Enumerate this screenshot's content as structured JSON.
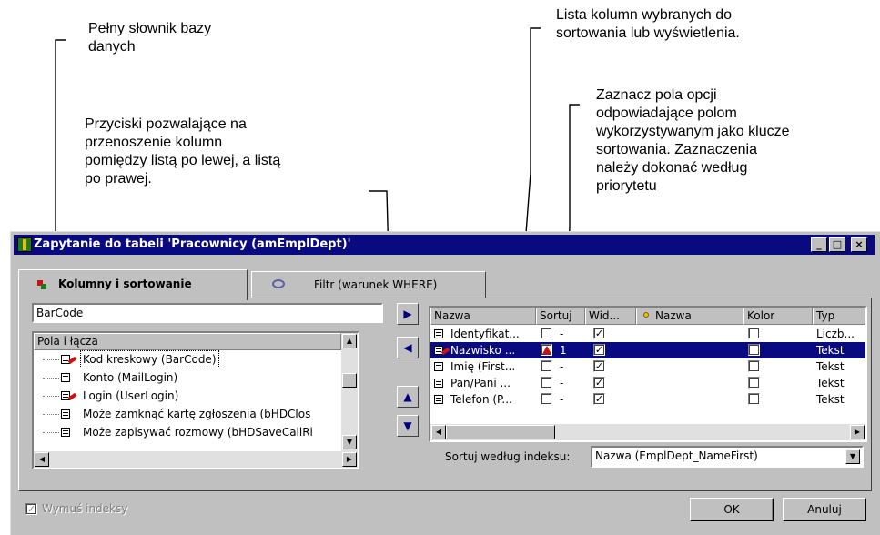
{
  "annotations": {
    "dictionary": "Pełny słownik bazy\ndanych",
    "columns_list": "Lista kolumn wybranych do\nsortowania lub wyświetlenia.",
    "checkboxes": "Zaznacz pola opcji\nodpowiadające polom\nwykorzystywanym jako klucze\nsortowania. Zaznaczenia\nnależy dokonać według\npriorytetu",
    "buttons": "Przyciski pozwalające na\nprzenoszenie kolumn\npomiędzy listą po lewej, a listą\npo prawej."
  },
  "window": {
    "title": "Zapytanie do tabeli 'Pracownicy (amEmplDept)'",
    "minimize": "_",
    "maximize": "□",
    "close": "×"
  },
  "tabs": [
    {
      "label": "Kolumny i sortowanie",
      "active": true,
      "icon": "columns-icon"
    },
    {
      "label": "Filtr (warunek WHERE)",
      "active": false,
      "icon": "filter-icon"
    }
  ],
  "left": {
    "search_value": "BarCode",
    "tree_header": "Pola i łącza",
    "items": [
      {
        "label": "Kod kreskowy (BarCode)",
        "icon": "linked-field-icon",
        "selected": true
      },
      {
        "label": "Konto (MailLogin)",
        "icon": "field-icon",
        "selected": false
      },
      {
        "label": "Login (UserLogin)",
        "icon": "linked-field-icon",
        "selected": false
      },
      {
        "label": "Może zamknąć kartę zgłoszenia (bHDClos",
        "icon": "field-icon",
        "selected": false
      },
      {
        "label": "Może zapisywać rozmowy (bHDSaveCallRi",
        "icon": "field-icon",
        "selected": false
      }
    ]
  },
  "move_buttons": [
    "▶",
    "◀",
    "▲",
    "▼"
  ],
  "grid": {
    "headers": [
      "Nazwa",
      "Sortuj",
      "Wid...",
      "Nazwa",
      "Kolor",
      "Typ"
    ],
    "rows": [
      {
        "name": "Identyfikat...",
        "sort": false,
        "sort_order": "-",
        "visible": true,
        "color": false,
        "type": "Liczb..."
      },
      {
        "name": "Nazwisko ...",
        "sort": true,
        "sort_order": "1",
        "visible": true,
        "color": false,
        "type": "Tekst"
      },
      {
        "name": "Imię (First...",
        "sort": false,
        "sort_order": "-",
        "visible": true,
        "color": false,
        "type": "Tekst"
      },
      {
        "name": "Pan/Pani ...",
        "sort": false,
        "sort_order": "-",
        "visible": true,
        "color": false,
        "type": "Tekst"
      },
      {
        "name": "Telefon (P...",
        "sort": false,
        "sort_order": "-",
        "visible": true,
        "color": false,
        "type": "Tekst"
      }
    ],
    "selected_row": 1
  },
  "index_sort": {
    "label": "Sortuj według indeksu:",
    "value": "Nazwa (EmplDept_NameFirst)"
  },
  "footer": {
    "force_indexes_label": "Wymuś indeksy",
    "force_indexes_checked": true,
    "ok_label": "OK",
    "cancel_label": "Anuluj"
  },
  "colors": {
    "title_bar": "#0a0a80",
    "dialog_face": "#c0c0c0",
    "selection": "#0a0a80",
    "sort_marker": "#d01010"
  }
}
